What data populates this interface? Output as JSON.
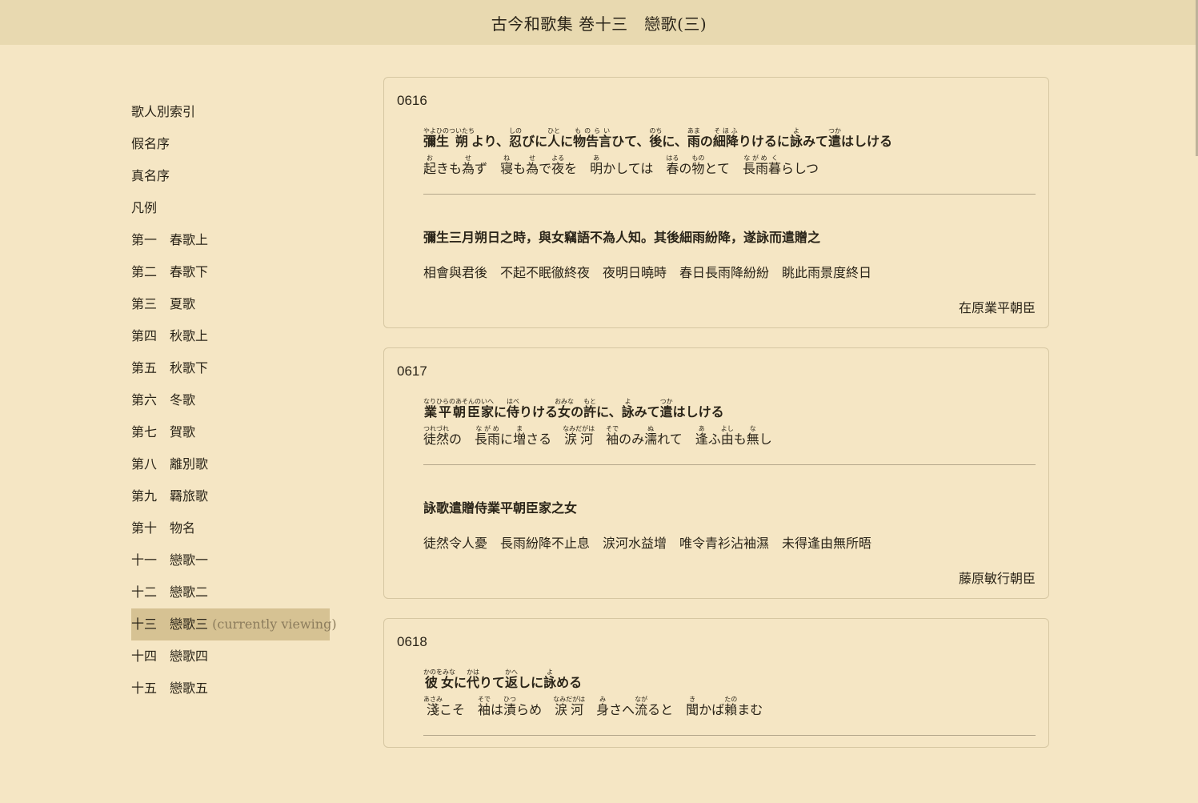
{
  "header": {
    "title": "古今和歌集 巻十三　戀歌(三)"
  },
  "sidebar": {
    "items": [
      {
        "num": "",
        "label": "歌人別索引"
      },
      {
        "num": "",
        "label": "假名序"
      },
      {
        "num": "",
        "label": "真名序"
      },
      {
        "num": "",
        "label": "凡例"
      },
      {
        "num": "第一",
        "label": "春歌上"
      },
      {
        "num": "第二",
        "label": "春歌下"
      },
      {
        "num": "第三",
        "label": "夏歌"
      },
      {
        "num": "第四",
        "label": "秋歌上"
      },
      {
        "num": "第五",
        "label": "秋歌下"
      },
      {
        "num": "第六",
        "label": "冬歌"
      },
      {
        "num": "第七",
        "label": "賀歌"
      },
      {
        "num": "第八",
        "label": "離別歌"
      },
      {
        "num": "第九",
        "label": "羇旅歌"
      },
      {
        "num": "第十",
        "label": "物名"
      },
      {
        "num": "十一",
        "label": "戀歌一"
      },
      {
        "num": "十二",
        "label": "戀歌二"
      },
      {
        "num": "十三",
        "label": "戀歌三",
        "current": "(currently viewing)"
      },
      {
        "num": "十四",
        "label": "戀歌四"
      },
      {
        "num": "十五",
        "label": "戀歌五"
      }
    ]
  },
  "poems": [
    {
      "id": "0616",
      "intro": [
        [
          "彌生",
          "やよひの"
        ],
        [
          "朔",
          "ついたち"
        ],
        [
          "より、",
          ""
        ],
        [
          "忍",
          "しの"
        ],
        [
          "びに",
          ""
        ],
        [
          "人",
          "ひと"
        ],
        [
          "に",
          ""
        ],
        [
          "物告言",
          "ものらい"
        ],
        [
          "ひて、",
          ""
        ],
        [
          "後",
          "のち"
        ],
        [
          "に、",
          ""
        ],
        [
          "雨",
          "あま"
        ],
        [
          "の",
          ""
        ],
        [
          "細降",
          "そほふ"
        ],
        [
          "りけるに",
          ""
        ],
        [
          "詠",
          "よ"
        ],
        [
          "みて",
          ""
        ],
        [
          "遣",
          "つか"
        ],
        [
          "はしける",
          ""
        ]
      ],
      "verse": [
        [
          "起",
          "お"
        ],
        [
          "きも",
          ""
        ],
        [
          "為",
          "せ"
        ],
        [
          "ず　",
          ""
        ],
        [
          "寝",
          "ね"
        ],
        [
          "も",
          ""
        ],
        [
          "為",
          "せ"
        ],
        [
          "で",
          ""
        ],
        [
          "夜",
          "よる"
        ],
        [
          "を　",
          ""
        ],
        [
          "明",
          "あ"
        ],
        [
          "かしては　",
          ""
        ],
        [
          "春",
          "はる"
        ],
        [
          "の",
          ""
        ],
        [
          "物",
          "もの"
        ],
        [
          "とて　",
          ""
        ],
        [
          "長雨",
          "ながめ"
        ],
        [
          "暮",
          "く"
        ],
        [
          "らしつ",
          ""
        ]
      ],
      "cn_title": "彌生三月朔日之時，與女竊語不為人知。其後細雨紛降，遂詠而遣贈之",
      "cn_text": "相會與君後　不起不眠徹終夜　夜明日曉時　春日長雨降紛紛　眺此雨景度終日",
      "author": "在原業平朝臣"
    },
    {
      "id": "0617",
      "intro": [
        [
          "業平朝臣",
          "なりひらのあそんの"
        ],
        [
          "家",
          "いへ"
        ],
        [
          "に",
          ""
        ],
        [
          "侍",
          "はべ"
        ],
        [
          "りける",
          ""
        ],
        [
          "女",
          "おみな"
        ],
        [
          "の",
          ""
        ],
        [
          "許",
          "もと"
        ],
        [
          "に、",
          ""
        ],
        [
          "詠",
          "よ"
        ],
        [
          "みて",
          ""
        ],
        [
          "遣",
          "つか"
        ],
        [
          "はしける",
          ""
        ]
      ],
      "verse": [
        [
          "徒然",
          "つれづれ"
        ],
        [
          "の　",
          ""
        ],
        [
          "長雨",
          "ながめ"
        ],
        [
          "に",
          ""
        ],
        [
          "増",
          "ま"
        ],
        [
          "さる　",
          ""
        ],
        [
          "涙河",
          "なみだがは"
        ],
        [
          "　",
          ""
        ],
        [
          "袖",
          "そで"
        ],
        [
          "のみ",
          ""
        ],
        [
          "濡",
          "ぬ"
        ],
        [
          "れて　",
          ""
        ],
        [
          "逢",
          "あ"
        ],
        [
          "ふ",
          ""
        ],
        [
          "由",
          "よし"
        ],
        [
          "も",
          ""
        ],
        [
          "無",
          "な"
        ],
        [
          "し",
          ""
        ]
      ],
      "cn_title": "詠歌遣贈侍業平朝臣家之女",
      "cn_text": "徒然令人憂　長雨紛降不止息　涙河水益增　唯令青衫沾袖濕　未得逢由無所晤",
      "author": "藤原敏行朝臣"
    },
    {
      "id": "0618",
      "intro": [
        [
          "彼女",
          "かのをみな"
        ],
        [
          "に",
          ""
        ],
        [
          "代",
          "かは"
        ],
        [
          "りて",
          ""
        ],
        [
          "返",
          "かへ"
        ],
        [
          "しに",
          ""
        ],
        [
          "詠",
          "よ"
        ],
        [
          "める",
          ""
        ]
      ],
      "verse": [
        [
          "淺",
          "あさみ"
        ],
        [
          "こそ　",
          ""
        ],
        [
          "袖",
          "そで"
        ],
        [
          "は",
          ""
        ],
        [
          "漬",
          "ひつ"
        ],
        [
          "らめ　",
          ""
        ],
        [
          "涙河",
          "なみだがは"
        ],
        [
          "　",
          ""
        ],
        [
          "身",
          "み"
        ],
        [
          "さへ",
          ""
        ],
        [
          "流",
          "なが"
        ],
        [
          "ると　",
          ""
        ],
        [
          "聞",
          "き"
        ],
        [
          "かば",
          ""
        ],
        [
          "賴",
          "たの"
        ],
        [
          "まむ",
          ""
        ]
      ],
      "cn_title": "",
      "cn_text": "",
      "author": ""
    }
  ]
}
